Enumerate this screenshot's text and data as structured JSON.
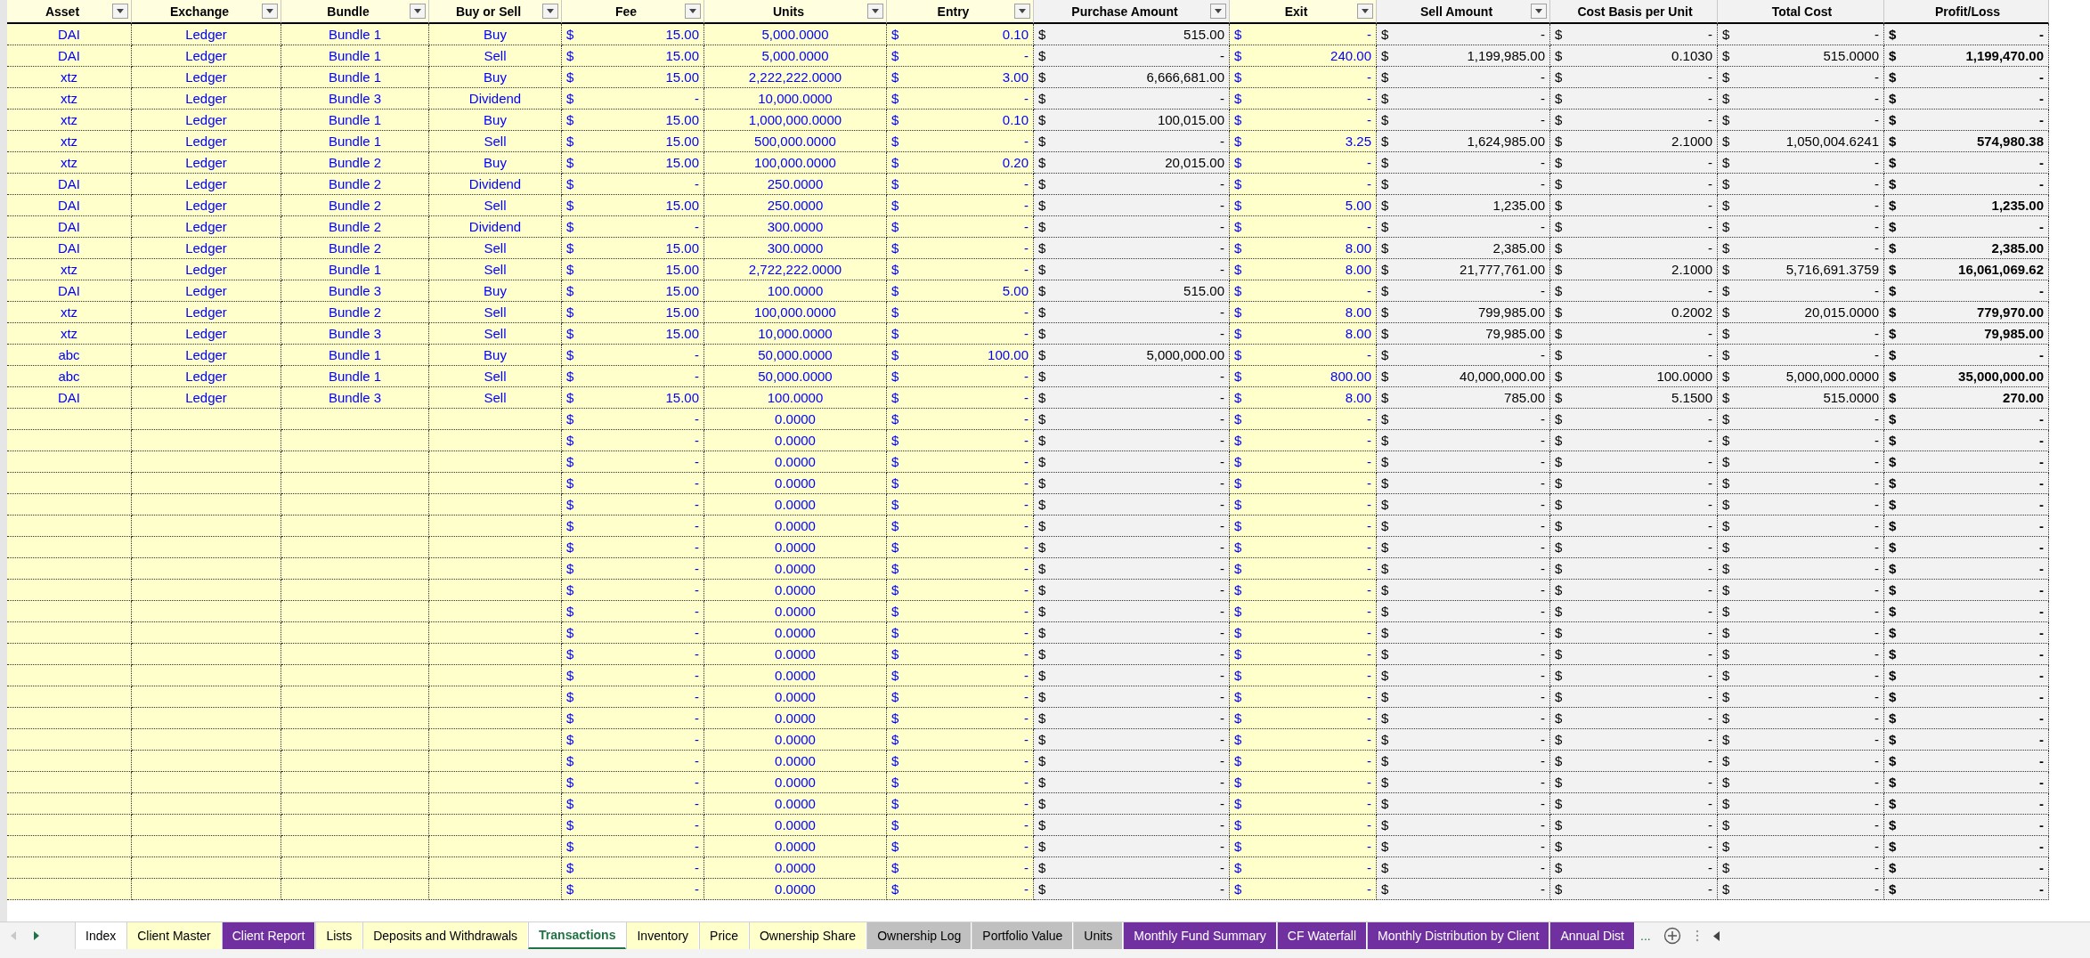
{
  "table": {
    "columns": [
      {
        "label": "Asset",
        "kind": "input",
        "filter": true
      },
      {
        "label": "Exchange",
        "kind": "input",
        "filter": true
      },
      {
        "label": "Bundle",
        "kind": "input",
        "filter": true
      },
      {
        "label": "Buy or Sell",
        "kind": "input",
        "filter": true
      },
      {
        "label": "Fee",
        "kind": "input",
        "filter": true
      },
      {
        "label": "Units",
        "kind": "input",
        "filter": true
      },
      {
        "label": "Entry",
        "kind": "input",
        "filter": true
      },
      {
        "label": "Purchase Amount",
        "kind": "calc",
        "filter": true
      },
      {
        "label": "Exit",
        "kind": "input",
        "filter": true
      },
      {
        "label": "Sell Amount",
        "kind": "calc",
        "filter": true
      },
      {
        "label": "Cost Basis per Unit",
        "kind": "calc",
        "filter": false
      },
      {
        "label": "Total Cost",
        "kind": "calc",
        "filter": false
      },
      {
        "label": "Profit/Loss",
        "kind": "total",
        "filter": false
      }
    ],
    "rows": [
      [
        "DAI",
        "Ledger",
        "Bundle 1",
        "Buy",
        [
          "$",
          "15.00"
        ],
        "5,000.0000",
        [
          "$",
          "0.10"
        ],
        [
          "$",
          "515.00"
        ],
        [
          "$",
          "-"
        ],
        [
          "$",
          "-"
        ],
        [
          "$",
          "-"
        ],
        [
          "$",
          "-"
        ],
        [
          "$",
          "-"
        ]
      ],
      [
        "DAI",
        "Ledger",
        "Bundle 1",
        "Sell",
        [
          "$",
          "15.00"
        ],
        "5,000.0000",
        [
          "$",
          "-"
        ],
        [
          "$",
          "-"
        ],
        [
          "$",
          "240.00"
        ],
        [
          "$",
          "1,199,985.00"
        ],
        [
          "$",
          "0.1030"
        ],
        [
          "$",
          "515.0000"
        ],
        [
          "$",
          "1,199,470.00"
        ]
      ],
      [
        "xtz",
        "Ledger",
        "Bundle 1",
        "Buy",
        [
          "$",
          "15.00"
        ],
        "2,222,222.0000",
        [
          "$",
          "3.00"
        ],
        [
          "$",
          "6,666,681.00"
        ],
        [
          "$",
          "-"
        ],
        [
          "$",
          "-"
        ],
        [
          "$",
          "-"
        ],
        [
          "$",
          "-"
        ],
        [
          "$",
          "-"
        ]
      ],
      [
        "xtz",
        "Ledger",
        "Bundle 3",
        "Dividend",
        [
          "$",
          "-"
        ],
        "10,000.0000",
        [
          "$",
          "-"
        ],
        [
          "$",
          "-"
        ],
        [
          "$",
          "-"
        ],
        [
          "$",
          "-"
        ],
        [
          "$",
          "-"
        ],
        [
          "$",
          "-"
        ],
        [
          "$",
          "-"
        ]
      ],
      [
        "xtz",
        "Ledger",
        "Bundle 1",
        "Buy",
        [
          "$",
          "15.00"
        ],
        "1,000,000.0000",
        [
          "$",
          "0.10"
        ],
        [
          "$",
          "100,015.00"
        ],
        [
          "$",
          "-"
        ],
        [
          "$",
          "-"
        ],
        [
          "$",
          "-"
        ],
        [
          "$",
          "-"
        ],
        [
          "$",
          "-"
        ]
      ],
      [
        "xtz",
        "Ledger",
        "Bundle 1",
        "Sell",
        [
          "$",
          "15.00"
        ],
        "500,000.0000",
        [
          "$",
          "-"
        ],
        [
          "$",
          "-"
        ],
        [
          "$",
          "3.25"
        ],
        [
          "$",
          "1,624,985.00"
        ],
        [
          "$",
          "2.1000"
        ],
        [
          "$",
          "1,050,004.6241"
        ],
        [
          "$",
          "574,980.38"
        ]
      ],
      [
        "xtz",
        "Ledger",
        "Bundle 2",
        "Buy",
        [
          "$",
          "15.00"
        ],
        "100,000.0000",
        [
          "$",
          "0.20"
        ],
        [
          "$",
          "20,015.00"
        ],
        [
          "$",
          "-"
        ],
        [
          "$",
          "-"
        ],
        [
          "$",
          "-"
        ],
        [
          "$",
          "-"
        ],
        [
          "$",
          "-"
        ]
      ],
      [
        "DAI",
        "Ledger",
        "Bundle 2",
        "Dividend",
        [
          "$",
          "-"
        ],
        "250.0000",
        [
          "$",
          "-"
        ],
        [
          "$",
          "-"
        ],
        [
          "$",
          "-"
        ],
        [
          "$",
          "-"
        ],
        [
          "$",
          "-"
        ],
        [
          "$",
          "-"
        ],
        [
          "$",
          "-"
        ]
      ],
      [
        "DAI",
        "Ledger",
        "Bundle 2",
        "Sell",
        [
          "$",
          "15.00"
        ],
        "250.0000",
        [
          "$",
          "-"
        ],
        [
          "$",
          "-"
        ],
        [
          "$",
          "5.00"
        ],
        [
          "$",
          "1,235.00"
        ],
        [
          "$",
          "-"
        ],
        [
          "$",
          "-"
        ],
        [
          "$",
          "1,235.00"
        ]
      ],
      [
        "DAI",
        "Ledger",
        "Bundle 2",
        "Dividend",
        [
          "$",
          "-"
        ],
        "300.0000",
        [
          "$",
          "-"
        ],
        [
          "$",
          "-"
        ],
        [
          "$",
          "-"
        ],
        [
          "$",
          "-"
        ],
        [
          "$",
          "-"
        ],
        [
          "$",
          "-"
        ],
        [
          "$",
          "-"
        ]
      ],
      [
        "DAI",
        "Ledger",
        "Bundle 2",
        "Sell",
        [
          "$",
          "15.00"
        ],
        "300.0000",
        [
          "$",
          "-"
        ],
        [
          "$",
          "-"
        ],
        [
          "$",
          "8.00"
        ],
        [
          "$",
          "2,385.00"
        ],
        [
          "$",
          "-"
        ],
        [
          "$",
          "-"
        ],
        [
          "$",
          "2,385.00"
        ]
      ],
      [
        "xtz",
        "Ledger",
        "Bundle 1",
        "Sell",
        [
          "$",
          "15.00"
        ],
        "2,722,222.0000",
        [
          "$",
          "-"
        ],
        [
          "$",
          "-"
        ],
        [
          "$",
          "8.00"
        ],
        [
          "$",
          "21,777,761.00"
        ],
        [
          "$",
          "2.1000"
        ],
        [
          "$",
          "5,716,691.3759"
        ],
        [
          "$",
          "16,061,069.62"
        ]
      ],
      [
        "DAI",
        "Ledger",
        "Bundle 3",
        "Buy",
        [
          "$",
          "15.00"
        ],
        "100.0000",
        [
          "$",
          "5.00"
        ],
        [
          "$",
          "515.00"
        ],
        [
          "$",
          "-"
        ],
        [
          "$",
          "-"
        ],
        [
          "$",
          "-"
        ],
        [
          "$",
          "-"
        ],
        [
          "$",
          "-"
        ]
      ],
      [
        "xtz",
        "Ledger",
        "Bundle 2",
        "Sell",
        [
          "$",
          "15.00"
        ],
        "100,000.0000",
        [
          "$",
          "-"
        ],
        [
          "$",
          "-"
        ],
        [
          "$",
          "8.00"
        ],
        [
          "$",
          "799,985.00"
        ],
        [
          "$",
          "0.2002"
        ],
        [
          "$",
          "20,015.0000"
        ],
        [
          "$",
          "779,970.00"
        ]
      ],
      [
        "xtz",
        "Ledger",
        "Bundle 3",
        "Sell",
        [
          "$",
          "15.00"
        ],
        "10,000.0000",
        [
          "$",
          "-"
        ],
        [
          "$",
          "-"
        ],
        [
          "$",
          "8.00"
        ],
        [
          "$",
          "79,985.00"
        ],
        [
          "$",
          "-"
        ],
        [
          "$",
          "-"
        ],
        [
          "$",
          "79,985.00"
        ]
      ],
      [
        "abc",
        "Ledger",
        "Bundle 1",
        "Buy",
        [
          "$",
          "-"
        ],
        "50,000.0000",
        [
          "$",
          "100.00"
        ],
        [
          "$",
          "5,000,000.00"
        ],
        [
          "$",
          "-"
        ],
        [
          "$",
          "-"
        ],
        [
          "$",
          "-"
        ],
        [
          "$",
          "-"
        ],
        [
          "$",
          "-"
        ]
      ],
      [
        "abc",
        "Ledger",
        "Bundle 1",
        "Sell",
        [
          "$",
          "-"
        ],
        "50,000.0000",
        [
          "$",
          "-"
        ],
        [
          "$",
          "-"
        ],
        [
          "$",
          "800.00"
        ],
        [
          "$",
          "40,000,000.00"
        ],
        [
          "$",
          "100.0000"
        ],
        [
          "$",
          "5,000,000.0000"
        ],
        [
          "$",
          "35,000,000.00"
        ]
      ],
      [
        "DAI",
        "Ledger",
        "Bundle 3",
        "Sell",
        [
          "$",
          "15.00"
        ],
        "100.0000",
        [
          "$",
          "-"
        ],
        [
          "$",
          "-"
        ],
        [
          "$",
          "8.00"
        ],
        [
          "$",
          "785.00"
        ],
        [
          "$",
          "5.1500"
        ],
        [
          "$",
          "515.0000"
        ],
        [
          "$",
          "270.00"
        ]
      ],
      [
        null,
        null,
        null,
        null,
        [
          "$",
          "-"
        ],
        "0.0000",
        [
          "$",
          "-"
        ],
        [
          "$",
          "-"
        ],
        [
          "$",
          "-"
        ],
        [
          "$",
          "-"
        ],
        [
          "$",
          "-"
        ],
        [
          "$",
          "-"
        ],
        [
          "$",
          "-"
        ]
      ],
      [
        null,
        null,
        null,
        null,
        [
          "$",
          "-"
        ],
        "0.0000",
        [
          "$",
          "-"
        ],
        [
          "$",
          "-"
        ],
        [
          "$",
          "-"
        ],
        [
          "$",
          "-"
        ],
        [
          "$",
          "-"
        ],
        [
          "$",
          "-"
        ],
        [
          "$",
          "-"
        ]
      ],
      [
        null,
        null,
        null,
        null,
        [
          "$",
          "-"
        ],
        "0.0000",
        [
          "$",
          "-"
        ],
        [
          "$",
          "-"
        ],
        [
          "$",
          "-"
        ],
        [
          "$",
          "-"
        ],
        [
          "$",
          "-"
        ],
        [
          "$",
          "-"
        ],
        [
          "$",
          "-"
        ]
      ],
      [
        null,
        null,
        null,
        null,
        [
          "$",
          "-"
        ],
        "0.0000",
        [
          "$",
          "-"
        ],
        [
          "$",
          "-"
        ],
        [
          "$",
          "-"
        ],
        [
          "$",
          "-"
        ],
        [
          "$",
          "-"
        ],
        [
          "$",
          "-"
        ],
        [
          "$",
          "-"
        ]
      ],
      [
        null,
        null,
        null,
        null,
        [
          "$",
          "-"
        ],
        "0.0000",
        [
          "$",
          "-"
        ],
        [
          "$",
          "-"
        ],
        [
          "$",
          "-"
        ],
        [
          "$",
          "-"
        ],
        [
          "$",
          "-"
        ],
        [
          "$",
          "-"
        ],
        [
          "$",
          "-"
        ]
      ],
      [
        null,
        null,
        null,
        null,
        [
          "$",
          "-"
        ],
        "0.0000",
        [
          "$",
          "-"
        ],
        [
          "$",
          "-"
        ],
        [
          "$",
          "-"
        ],
        [
          "$",
          "-"
        ],
        [
          "$",
          "-"
        ],
        [
          "$",
          "-"
        ],
        [
          "$",
          "-"
        ]
      ],
      [
        null,
        null,
        null,
        null,
        [
          "$",
          "-"
        ],
        "0.0000",
        [
          "$",
          "-"
        ],
        [
          "$",
          "-"
        ],
        [
          "$",
          "-"
        ],
        [
          "$",
          "-"
        ],
        [
          "$",
          "-"
        ],
        [
          "$",
          "-"
        ],
        [
          "$",
          "-"
        ]
      ],
      [
        null,
        null,
        null,
        null,
        [
          "$",
          "-"
        ],
        "0.0000",
        [
          "$",
          "-"
        ],
        [
          "$",
          "-"
        ],
        [
          "$",
          "-"
        ],
        [
          "$",
          "-"
        ],
        [
          "$",
          "-"
        ],
        [
          "$",
          "-"
        ],
        [
          "$",
          "-"
        ]
      ],
      [
        null,
        null,
        null,
        null,
        [
          "$",
          "-"
        ],
        "0.0000",
        [
          "$",
          "-"
        ],
        [
          "$",
          "-"
        ],
        [
          "$",
          "-"
        ],
        [
          "$",
          "-"
        ],
        [
          "$",
          "-"
        ],
        [
          "$",
          "-"
        ],
        [
          "$",
          "-"
        ]
      ],
      [
        null,
        null,
        null,
        null,
        [
          "$",
          "-"
        ],
        "0.0000",
        [
          "$",
          "-"
        ],
        [
          "$",
          "-"
        ],
        [
          "$",
          "-"
        ],
        [
          "$",
          "-"
        ],
        [
          "$",
          "-"
        ],
        [
          "$",
          "-"
        ],
        [
          "$",
          "-"
        ]
      ],
      [
        null,
        null,
        null,
        null,
        [
          "$",
          "-"
        ],
        "0.0000",
        [
          "$",
          "-"
        ],
        [
          "$",
          "-"
        ],
        [
          "$",
          "-"
        ],
        [
          "$",
          "-"
        ],
        [
          "$",
          "-"
        ],
        [
          "$",
          "-"
        ],
        [
          "$",
          "-"
        ]
      ],
      [
        null,
        null,
        null,
        null,
        [
          "$",
          "-"
        ],
        "0.0000",
        [
          "$",
          "-"
        ],
        [
          "$",
          "-"
        ],
        [
          "$",
          "-"
        ],
        [
          "$",
          "-"
        ],
        [
          "$",
          "-"
        ],
        [
          "$",
          "-"
        ],
        [
          "$",
          "-"
        ]
      ],
      [
        null,
        null,
        null,
        null,
        [
          "$",
          "-"
        ],
        "0.0000",
        [
          "$",
          "-"
        ],
        [
          "$",
          "-"
        ],
        [
          "$",
          "-"
        ],
        [
          "$",
          "-"
        ],
        [
          "$",
          "-"
        ],
        [
          "$",
          "-"
        ],
        [
          "$",
          "-"
        ]
      ],
      [
        null,
        null,
        null,
        null,
        [
          "$",
          "-"
        ],
        "0.0000",
        [
          "$",
          "-"
        ],
        [
          "$",
          "-"
        ],
        [
          "$",
          "-"
        ],
        [
          "$",
          "-"
        ],
        [
          "$",
          "-"
        ],
        [
          "$",
          "-"
        ],
        [
          "$",
          "-"
        ]
      ],
      [
        null,
        null,
        null,
        null,
        [
          "$",
          "-"
        ],
        "0.0000",
        [
          "$",
          "-"
        ],
        [
          "$",
          "-"
        ],
        [
          "$",
          "-"
        ],
        [
          "$",
          "-"
        ],
        [
          "$",
          "-"
        ],
        [
          "$",
          "-"
        ],
        [
          "$",
          "-"
        ]
      ],
      [
        null,
        null,
        null,
        null,
        [
          "$",
          "-"
        ],
        "0.0000",
        [
          "$",
          "-"
        ],
        [
          "$",
          "-"
        ],
        [
          "$",
          "-"
        ],
        [
          "$",
          "-"
        ],
        [
          "$",
          "-"
        ],
        [
          "$",
          "-"
        ],
        [
          "$",
          "-"
        ]
      ],
      [
        null,
        null,
        null,
        null,
        [
          "$",
          "-"
        ],
        "0.0000",
        [
          "$",
          "-"
        ],
        [
          "$",
          "-"
        ],
        [
          "$",
          "-"
        ],
        [
          "$",
          "-"
        ],
        [
          "$",
          "-"
        ],
        [
          "$",
          "-"
        ],
        [
          "$",
          "-"
        ]
      ],
      [
        null,
        null,
        null,
        null,
        [
          "$",
          "-"
        ],
        "0.0000",
        [
          "$",
          "-"
        ],
        [
          "$",
          "-"
        ],
        [
          "$",
          "-"
        ],
        [
          "$",
          "-"
        ],
        [
          "$",
          "-"
        ],
        [
          "$",
          "-"
        ],
        [
          "$",
          "-"
        ]
      ],
      [
        null,
        null,
        null,
        null,
        [
          "$",
          "-"
        ],
        "0.0000",
        [
          "$",
          "-"
        ],
        [
          "$",
          "-"
        ],
        [
          "$",
          "-"
        ],
        [
          "$",
          "-"
        ],
        [
          "$",
          "-"
        ],
        [
          "$",
          "-"
        ],
        [
          "$",
          "-"
        ]
      ],
      [
        null,
        null,
        null,
        null,
        [
          "$",
          "-"
        ],
        "0.0000",
        [
          "$",
          "-"
        ],
        [
          "$",
          "-"
        ],
        [
          "$",
          "-"
        ],
        [
          "$",
          "-"
        ],
        [
          "$",
          "-"
        ],
        [
          "$",
          "-"
        ],
        [
          "$",
          "-"
        ]
      ],
      [
        null,
        null,
        null,
        null,
        [
          "$",
          "-"
        ],
        "0.0000",
        [
          "$",
          "-"
        ],
        [
          "$",
          "-"
        ],
        [
          "$",
          "-"
        ],
        [
          "$",
          "-"
        ],
        [
          "$",
          "-"
        ],
        [
          "$",
          "-"
        ],
        [
          "$",
          "-"
        ]
      ],
      [
        null,
        null,
        null,
        null,
        [
          "$",
          "-"
        ],
        "0.0000",
        [
          "$",
          "-"
        ],
        [
          "$",
          "-"
        ],
        [
          "$",
          "-"
        ],
        [
          "$",
          "-"
        ],
        [
          "$",
          "-"
        ],
        [
          "$",
          "-"
        ],
        [
          "$",
          "-"
        ]
      ],
      [
        null,
        null,
        null,
        null,
        [
          "$",
          "-"
        ],
        "0.0000",
        [
          "$",
          "-"
        ],
        [
          "$",
          "-"
        ],
        [
          "$",
          "-"
        ],
        [
          "$",
          "-"
        ],
        [
          "$",
          "-"
        ],
        [
          "$",
          "-"
        ],
        [
          "$",
          "-"
        ]
      ]
    ]
  },
  "sheet_tabs": [
    {
      "label": "Index",
      "color": "#ffffff",
      "selected": false
    },
    {
      "label": "Client Master",
      "color": "#ffffcc",
      "selected": false
    },
    {
      "label": "Client Report",
      "color": "#7030a0",
      "selected": false
    },
    {
      "label": "Lists",
      "color": "#ffffcc",
      "selected": false
    },
    {
      "label": "Deposits and Withdrawals",
      "color": "#ffffcc",
      "selected": false
    },
    {
      "label": "Transactions",
      "color": "#ffffff",
      "selected": true
    },
    {
      "label": "Inventory",
      "color": "#ffffcc",
      "selected": false
    },
    {
      "label": "Price",
      "color": "#ffffcc",
      "selected": false
    },
    {
      "label": "Ownership Share",
      "color": "#ffffcc",
      "selected": false
    },
    {
      "label": "Ownership Log",
      "color": "#c0c0c0",
      "selected": false
    },
    {
      "label": "Portfolio Value",
      "color": "#c0c0c0",
      "selected": false
    },
    {
      "label": "Units",
      "color": "#c0c0c0",
      "selected": false
    },
    {
      "label": "Monthly Fund Summary",
      "color": "#7030a0",
      "selected": false
    },
    {
      "label": "CF Waterfall",
      "color": "#7030a0",
      "selected": false
    },
    {
      "label": "Monthly Distribution by Client",
      "color": "#7030a0",
      "selected": false
    },
    {
      "label": "Annual Dist",
      "color": "#7030a0",
      "selected": false
    }
  ],
  "more_tabs": "..."
}
